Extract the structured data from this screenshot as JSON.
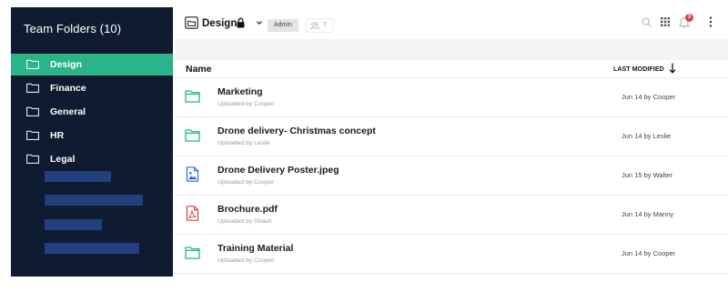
{
  "sidebar": {
    "title": "Team Folders (10)",
    "items": [
      {
        "label": "Design",
        "active": true
      },
      {
        "label": "Finance",
        "active": false
      },
      {
        "label": "General",
        "active": false
      },
      {
        "label": "HR",
        "active": false
      },
      {
        "label": "Legal",
        "active": false
      }
    ]
  },
  "header": {
    "folder_title": "Design",
    "role_badge": "Admin",
    "member_count": "7",
    "notification_count": "3"
  },
  "table": {
    "col_name": "Name",
    "col_modified": "LAST MODIFIED",
    "rows": [
      {
        "name": "Marketing",
        "sub": "Uploaded by Cooper",
        "modified": "Jun 14 by Cooper",
        "type": "folder"
      },
      {
        "name": "Drone delivery- Christmas concept",
        "sub": "Uploaded by Leslie",
        "modified": "Jun 14 by Leslie",
        "type": "folder"
      },
      {
        "name": "Drone Delivery Poster.jpeg",
        "sub": "Uploaded by Cooper",
        "modified": "Jun 15 by Walter",
        "type": "image"
      },
      {
        "name": "Brochure.pdf",
        "sub": "Uploaded by Shaun",
        "modified": "Jun 14 by Manny",
        "type": "pdf"
      },
      {
        "name": "Training Material",
        "sub": "Uploaded by Cooper",
        "modified": "Jun 14 by Cooper",
        "type": "folder"
      }
    ]
  },
  "icons": {
    "folder": "folder-icon",
    "image": "image-file-icon",
    "pdf": "pdf-file-icon",
    "lock": "lock-icon",
    "search": "search-icon",
    "apps": "apps-grid-icon",
    "bell": "bell-icon",
    "more": "more-vertical-icon",
    "sort": "sort-down-arrow-icon"
  },
  "colors": {
    "sidebar_bg": "#0e1b30",
    "active_item": "#2bb38a",
    "folder_icon": "#2bb38a",
    "image_icon": "#2f6fd6",
    "pdf_icon": "#e0413b",
    "badge": "#e0413b",
    "placeholder_bar": "#233f7e"
  }
}
